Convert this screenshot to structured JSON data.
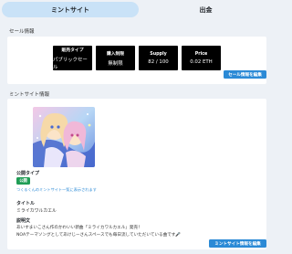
{
  "tabs": {
    "active": "ミントサイト",
    "inactive": "出金"
  },
  "sale_info": {
    "section_label": "セール情報",
    "stats": [
      {
        "label": "販売タイプ",
        "value": "パブリックセール"
      },
      {
        "label": "購入制限",
        "value": "無制限"
      },
      {
        "label": "Supply",
        "value": "82 / 100"
      },
      {
        "label": "Price",
        "value": "0.02 ETH"
      }
    ],
    "edit_button": "セール情報を編集"
  },
  "mint_site": {
    "section_label": "ミントサイト情報",
    "public_type_label": "公開タイプ",
    "public_badge": "公開",
    "public_note": "つくるくんのミントサイト一覧に表示されます",
    "title_label": "タイトル",
    "title_value": "ミライカワルカエル",
    "description_label": "説明文",
    "description_line1": "あいすまいこさん作のかわいい新曲「ミライカワルカエル」発売！",
    "description_line2": "NOAテーマソングとしてあけじーさんスペースでも毎日流していただいている曲です🎤",
    "edit_button": "ミントサイト情報を編集"
  },
  "colors": {
    "accent": "#2b8ad6",
    "public_badge": "#1f9d55",
    "tab_active": "#c9e2f7"
  }
}
